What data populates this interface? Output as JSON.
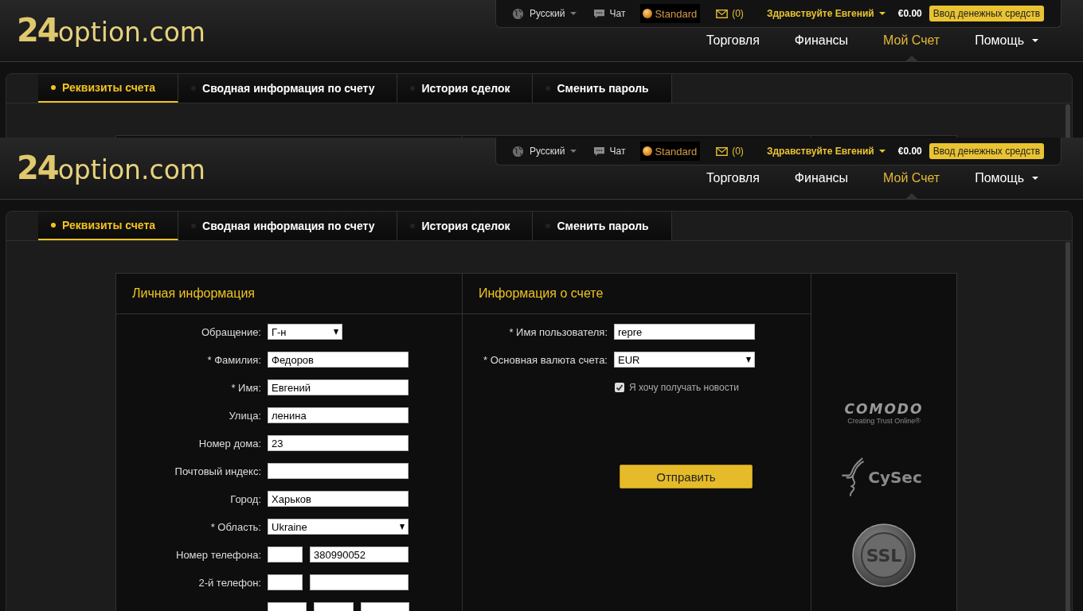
{
  "layers": [
    {
      "header": {
        "logo": {
          "number": "24",
          "text": "option.com"
        },
        "topbar": {
          "language": "Русский",
          "chat": "Чат",
          "account_type": "Standard",
          "messages": "(0)",
          "greeting": "Здравствуйте Евгений",
          "balance": "€0.00",
          "deposit_button": "Ввод денежных средств"
        },
        "nav": [
          {
            "label": "Торговля",
            "selected": false,
            "has_menu": false
          },
          {
            "label": "Финансы",
            "selected": false,
            "has_menu": false
          },
          {
            "label": "Мой Счет",
            "selected": true,
            "has_menu": false
          },
          {
            "label": "Помощь",
            "selected": false,
            "has_menu": true
          }
        ]
      },
      "tabs": [
        {
          "label": "Реквизиты счета",
          "selected": true
        },
        {
          "label": "Сводная информация по счету",
          "selected": false
        },
        {
          "label": "История сделок",
          "selected": false
        },
        {
          "label": "Сменить пароль",
          "selected": false
        }
      ]
    },
    {
      "header": {
        "logo": {
          "number": "24",
          "text": "option.com"
        },
        "topbar": {
          "language": "Русский",
          "chat": "Чат",
          "account_type": "Standard",
          "messages": "(0)",
          "greeting": "Здравствуйте Евгений",
          "balance": "€0.00",
          "deposit_button": "Ввод денежных средств"
        },
        "nav": [
          {
            "label": "Торговля",
            "selected": false,
            "has_menu": false
          },
          {
            "label": "Финансы",
            "selected": false,
            "has_menu": false
          },
          {
            "label": "Мой Счет",
            "selected": true,
            "has_menu": false
          },
          {
            "label": "Помощь",
            "selected": false,
            "has_menu": true
          }
        ]
      },
      "tabs": [
        {
          "label": "Реквизиты счета",
          "selected": true
        },
        {
          "label": "Сводная информация по счету",
          "selected": false
        },
        {
          "label": "История сделок",
          "selected": false
        },
        {
          "label": "Сменить пароль",
          "selected": false
        }
      ],
      "personal": {
        "title": "Личная информация",
        "rows": [
          {
            "kind": "short-select",
            "label": "Обращение:",
            "value": "Г-н"
          },
          {
            "kind": "text",
            "label": "* Фамилия:",
            "value": "Федоров"
          },
          {
            "kind": "text",
            "label": "* Имя:",
            "value": "Евгений"
          },
          {
            "kind": "text",
            "label": "Улица:",
            "value": "ленина"
          },
          {
            "kind": "text",
            "label": "Номер дома:",
            "value": "23"
          },
          {
            "kind": "text",
            "label": "Почтовый индекс:"
          },
          {
            "kind": "text",
            "label": "Город:",
            "value": "Харьков"
          },
          {
            "kind": "select",
            "label": "* Область:",
            "value": "Ukraine"
          },
          {
            "kind": "phone",
            "label": "Номер телефона:",
            "value": "380990052"
          },
          {
            "kind": "phone",
            "label": "2-й телефон:"
          },
          {
            "kind": "triple"
          }
        ]
      },
      "account": {
        "title": "Информация о счете",
        "rows": [
          {
            "kind": "text",
            "label": "* Имя пользователя:",
            "value": "repre"
          },
          {
            "kind": "select",
            "label": "* Основная валюта счета:",
            "value": "EUR"
          }
        ],
        "newsletter": {
          "label": "Я хочу получать новости",
          "checked": true
        },
        "submit": "Отправить"
      },
      "trust_badges": {
        "comodo": "COMODO",
        "comodo_tagline": "Creating Trust Online®",
        "cysec": "CySec",
        "ssl": "SSL"
      }
    }
  ]
}
